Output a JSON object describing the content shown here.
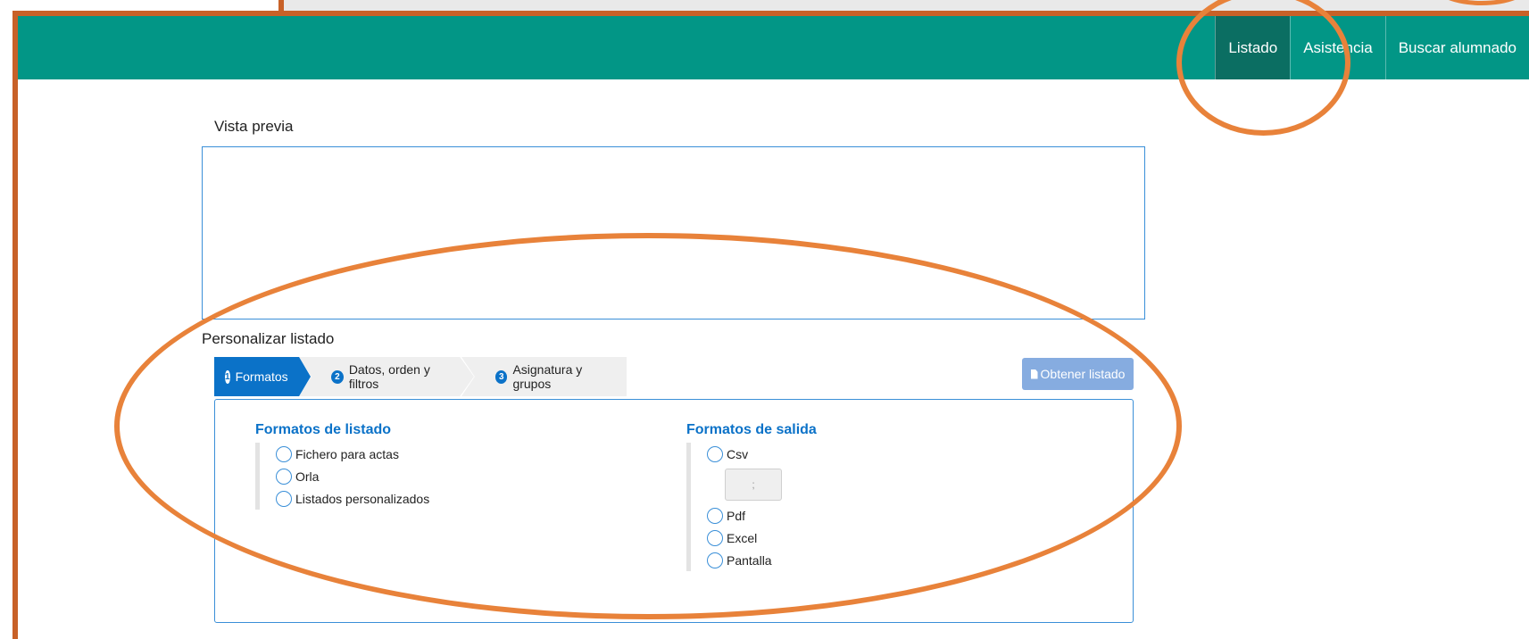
{
  "navbar": {
    "items": [
      {
        "label": "Listado",
        "active": true
      },
      {
        "label": "Asistencia",
        "active": false
      },
      {
        "label": "Buscar alumnado",
        "active": false
      }
    ]
  },
  "preview": {
    "title": "Vista previa"
  },
  "customize": {
    "title": "Personalizar listado",
    "steps": [
      {
        "num": "1",
        "label": "Formatos"
      },
      {
        "num": "2",
        "label": "Datos, orden y filtros"
      },
      {
        "num": "3",
        "label": "Asignatura y grupos"
      }
    ],
    "obtain_button": "Obtener listado"
  },
  "list_formats": {
    "title": "Formatos de listado",
    "options": [
      "Fichero para actas",
      "Orla",
      "Listados personalizados"
    ]
  },
  "output_formats": {
    "title": "Formatos de salida",
    "options": [
      "Csv",
      "Pdf",
      "Excel",
      "Pantalla"
    ],
    "csv_separator": ";"
  },
  "colors": {
    "navbar": "#029686",
    "navbar_active": "#0b6e62",
    "accent_blue": "#0b72c8",
    "annotation": "#e8823a"
  }
}
